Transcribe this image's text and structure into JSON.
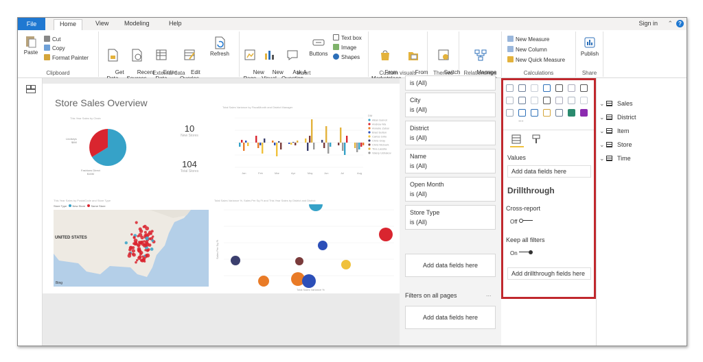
{
  "tabs": {
    "file": "File",
    "home": "Home",
    "view": "View",
    "modeling": "Modeling",
    "help": "Help",
    "signin": "Sign in"
  },
  "ribbon": {
    "clipboard": {
      "paste": "Paste",
      "cut": "Cut",
      "copy": "Copy",
      "format_painter": "Format Painter",
      "label": "Clipboard"
    },
    "external": {
      "get_data": "Get\nData",
      "recent": "Recent\nSources",
      "enter": "Enter\nData",
      "edit": "Edit\nQueries",
      "refresh": "Refresh",
      "label": "External data"
    },
    "insert": {
      "new_page": "New\nPage",
      "new_visual": "New\nVisual",
      "ask": "Ask A\nQuestion",
      "buttons": "Buttons",
      "textbox": "Text box",
      "image": "Image",
      "shapes": "Shapes",
      "label": "Insert"
    },
    "custom": {
      "marketplace": "From\nMarketplace",
      "file": "From\nFile",
      "label": "Custom visuals"
    },
    "themes": {
      "switch": "Switch\nTheme",
      "label": "Themes"
    },
    "relationships": {
      "manage": "Manage\nRelationships",
      "label": "Relationships"
    },
    "calculations": {
      "measure": "New Measure",
      "column": "New Column",
      "quick": "New Quick Measure",
      "label": "Calculations"
    },
    "share": {
      "publish": "Publish",
      "label": "Share"
    }
  },
  "report": {
    "title": "Store Sales Overview",
    "pie_title": "This Year Sales by Chain",
    "pie_labels": [
      "Lindseys\n$6M",
      "Fashions Direct\n$16M"
    ],
    "kpi1": {
      "value": "10",
      "label": "New Stores"
    },
    "kpi2": {
      "value": "104",
      "label": "Total Stores"
    },
    "bar_title": "Total Sales Variance by FiscalMonth and District Manager",
    "bar_legend": [
      "Allan Guinot",
      "Andrew Ma",
      "Annelie Zubar",
      "Brad Sutton",
      "Carlos Grilo",
      "Chris Gray",
      "Chris McGurk",
      "Tina Lassila",
      "Valery Ushakov"
    ],
    "bar_legend_title": "DM",
    "bar_months": [
      "Jan",
      "Feb",
      "Mar",
      "Apr",
      "May",
      "Jun",
      "Jul",
      "Aug"
    ],
    "map_title": "This Year Sales by PostalCode and Store Type",
    "map_legend": [
      "Store Type",
      "New Store",
      "Same Store"
    ],
    "map_country": "UNITED STATES",
    "map_bing": "Bing",
    "scatter_title": "Total Sales Variance %, Sales Per Sq Ft and This Year Sales by District and District",
    "scatter_xlabel": "Total Sales Variance %",
    "scatter_ylabel": "Sales Per Sq Ft"
  },
  "colors": {
    "pie_a": "#36a2c8",
    "pie_b": "#d9252f",
    "accent": "#1f78d1",
    "highlight": "#c0282d"
  },
  "filters": {
    "cards": [
      {
        "name": "",
        "value": "is (All)"
      },
      {
        "name": "City",
        "value": "is (All)"
      },
      {
        "name": "District",
        "value": "is (All)"
      },
      {
        "name": "Name",
        "value": "is (All)"
      },
      {
        "name": "Open Month",
        "value": "is (All)"
      },
      {
        "name": "Store Type",
        "value": "is (All)"
      }
    ],
    "add_fields": "Add data fields here",
    "all_pages": "Filters on all pages",
    "all_pages_more": "...",
    "add_fields_all": "Add data fields here"
  },
  "viz": {
    "values_label": "Values",
    "values_drop": "Add data fields here",
    "drillthrough": "Drillthrough",
    "cross_report": "Cross-report",
    "cross_state": "Off",
    "keep_filters": "Keep all filters",
    "keep_state": "On",
    "drill_drop": "Add drillthrough fields here",
    "more": "..."
  },
  "fields": [
    "Sales",
    "District",
    "Item",
    "Store",
    "Time"
  ]
}
